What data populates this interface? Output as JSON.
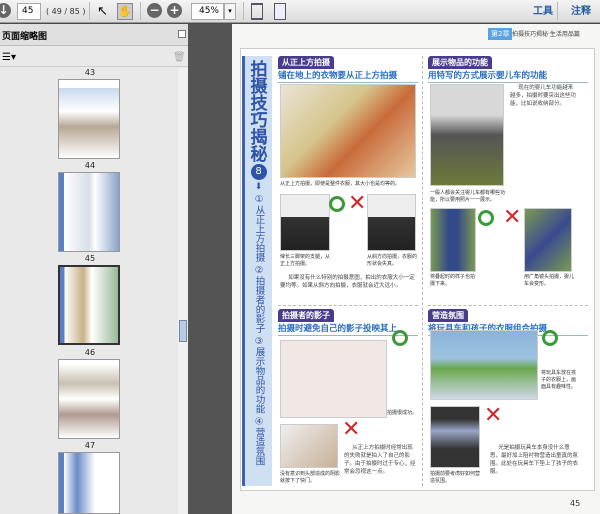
{
  "toolbar": {
    "page_current": "45",
    "page_info": "( 49 / 85 )",
    "zoom": "45%",
    "tools_label": "工具",
    "comment_label": "注释"
  },
  "sidebar": {
    "title": "页面缩略图",
    "thumbnails": [
      {
        "label": "43"
      },
      {
        "label": "44"
      },
      {
        "label": "45"
      },
      {
        "label": "46"
      },
      {
        "label": "47"
      }
    ]
  },
  "page": {
    "chapter_badge": "第2章",
    "chapter_title": "拍摄技巧揭秘·生活用品篇",
    "side_title": "拍摄技巧揭秘",
    "side_number": "8",
    "side_items": [
      "①从正上方拍摄",
      "②拍摄者的影子",
      "③展示物品的功能",
      "④营造氛围"
    ],
    "sec1": {
      "tag": "从正上方拍摄",
      "subtitle": "铺在地上的衣物要从正上方拍摄",
      "cap_main": "从正上方拍摄，即使是整件衣服，其大小也是均等的。",
      "cap_ok": "俾长三脚架的支腿，从正上方拍摄。",
      "cap_ng": "从斜方向拍摄，衣服的形状会失真。",
      "body": "如果没有什么特别的拍摄意图，拍出的衣服大小一定要均等。如果从斜方向拍摄，衣服就会近大远小。"
    },
    "sec2": {
      "tag": "拍摄者的影子",
      "subtitle": "拍摄时避免自己的影子投映其上",
      "cap_ok": "拍摄很成功。",
      "cap_ng": "没有意识到头部造成的阴影就按下了快门。",
      "body": "从正上方拍摄时经常出现的失败就是拍入了自己的影子。由于拍摄时过于专心，经常会忽视这一点。"
    },
    "sec3": {
      "tag": "展示物品的功能",
      "subtitle": "用特写的方式展示婴儿车的功能",
      "intro": "现在的婴儿车功能越来越多，拍摄时要突出这些功能，比如说收纳部分。",
      "cap_main": "一般人都会关注婴儿车都有哪些功能，所以要用照片一一展示。",
      "cap_ok": "将叠起时的样子也拍摄下来。",
      "cap_ng": "用广角镜头拍摄，婴儿车会变形。"
    },
    "sec4": {
      "tag": "营造氛围",
      "subtitle": "将玩具车和孩子的衣服组合拍摄",
      "cap_ok": "将玩具车放在孩子的衣服上，画面具有趣味性。",
      "cap_ng": "拍摄前要考虑好如何营造氛围。",
      "body": "光是拍摄玩具车本身没什么意思，最好加上陪衬物营造出童真的氛围。此处在玩具车下垫上了孩子的衣服。"
    },
    "page_number": "45"
  }
}
